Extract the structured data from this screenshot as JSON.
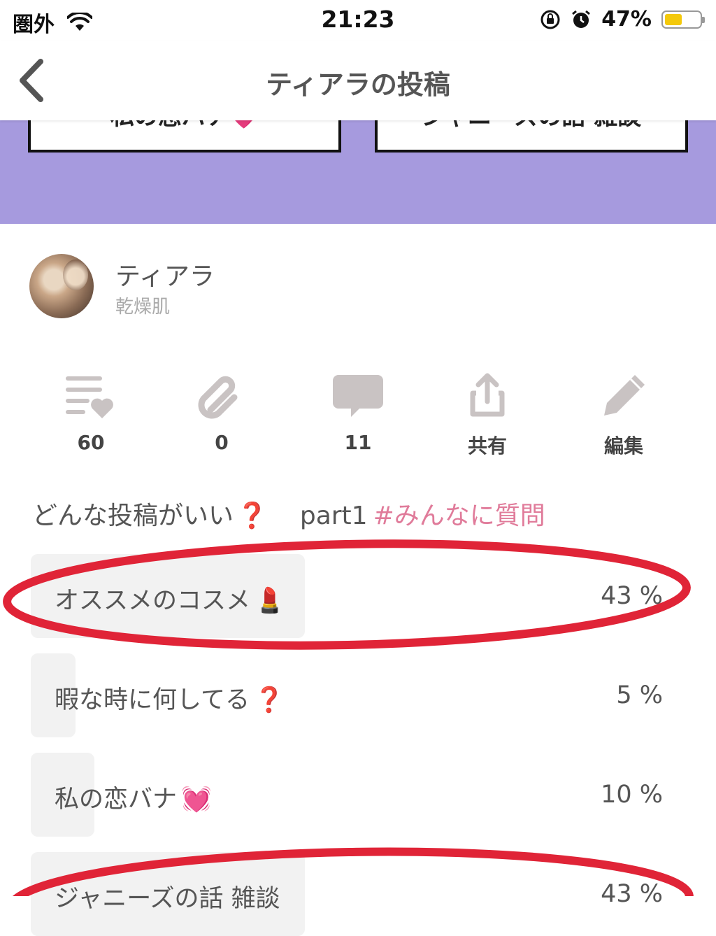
{
  "status_bar": {
    "carrier": "圏外",
    "time": "21:23",
    "battery_percent": "47%",
    "battery_level": 0.47,
    "battery_color": "#f4c90b"
  },
  "nav": {
    "title": "ティアラの投稿",
    "back_icon": "chevron-left-icon"
  },
  "banner": {
    "color": "#a69ade",
    "cards": [
      "私の恋バナ💗",
      "ジャニーズの話 雑談"
    ]
  },
  "profile": {
    "name": "ティアラ",
    "skin_type": "乾燥肌"
  },
  "actions": [
    {
      "icon": "clip-list-heart-icon",
      "label": "60"
    },
    {
      "icon": "paperclip-icon",
      "label": "0"
    },
    {
      "icon": "comment-icon",
      "label": "11"
    },
    {
      "icon": "share-icon",
      "label": "共有"
    },
    {
      "icon": "pencil-icon",
      "label": "編集"
    }
  ],
  "post": {
    "question_text": "どんな投稿がいい",
    "question_mark": "❓",
    "part": "part1",
    "hashtag": "#みんなに質問"
  },
  "poll": {
    "options": [
      {
        "label": "オススメのコスメ",
        "emoji": "💄",
        "percent_text": "43 %",
        "percent": 43,
        "highlighted": true
      },
      {
        "label": "暇な時に何してる",
        "emoji": "❓",
        "percent_text": "5 %",
        "percent": 5,
        "highlighted": false
      },
      {
        "label": "私の恋バナ",
        "emoji": "💓",
        "percent_text": "10 %",
        "percent": 10,
        "highlighted": false
      },
      {
        "label": "ジャニーズの話 雑談",
        "emoji": "",
        "percent_text": "43 %",
        "percent": 43,
        "highlighted": true
      }
    ]
  },
  "annotation_color": "#e02437"
}
